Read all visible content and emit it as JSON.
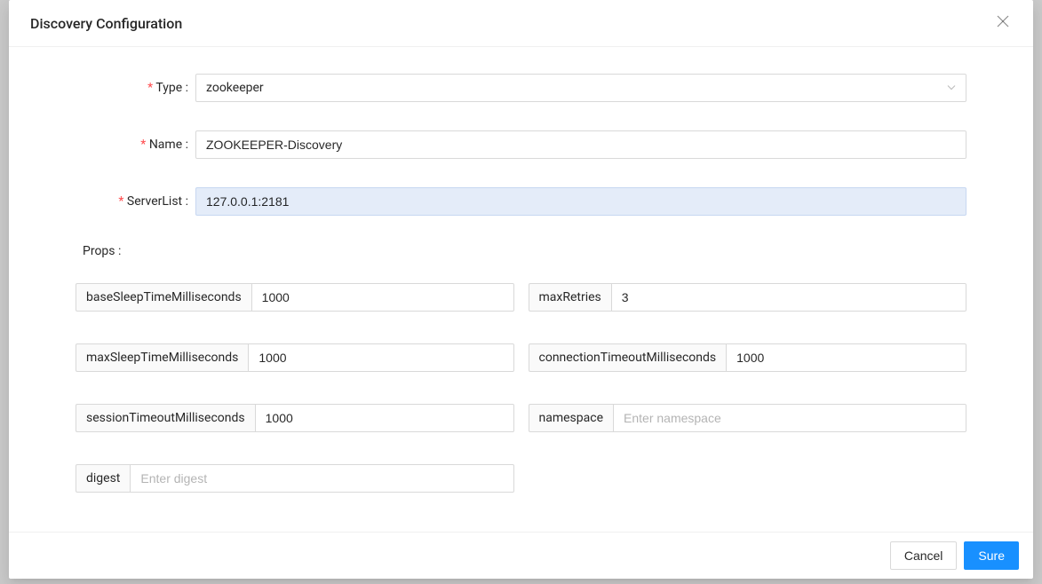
{
  "modal": {
    "title": "Discovery Configuration"
  },
  "form": {
    "type": {
      "label": "Type",
      "value": "zookeeper"
    },
    "name": {
      "label": "Name",
      "value": "ZOOKEEPER-Discovery"
    },
    "serverList": {
      "label": "ServerList",
      "value": "127.0.0.1:2181"
    },
    "props": {
      "label": "Props",
      "items": [
        {
          "key": "baseSleepTimeMilliseconds",
          "value": "1000",
          "placeholder": ""
        },
        {
          "key": "maxRetries",
          "value": "3",
          "placeholder": ""
        },
        {
          "key": "maxSleepTimeMilliseconds",
          "value": "1000",
          "placeholder": ""
        },
        {
          "key": "connectionTimeoutMilliseconds",
          "value": "1000",
          "placeholder": ""
        },
        {
          "key": "sessionTimeoutMilliseconds",
          "value": "1000",
          "placeholder": ""
        },
        {
          "key": "namespace",
          "value": "",
          "placeholder": "Enter namespace"
        },
        {
          "key": "digest",
          "value": "",
          "placeholder": "Enter digest"
        }
      ]
    }
  },
  "footer": {
    "cancel": "Cancel",
    "confirm": "Sure"
  }
}
